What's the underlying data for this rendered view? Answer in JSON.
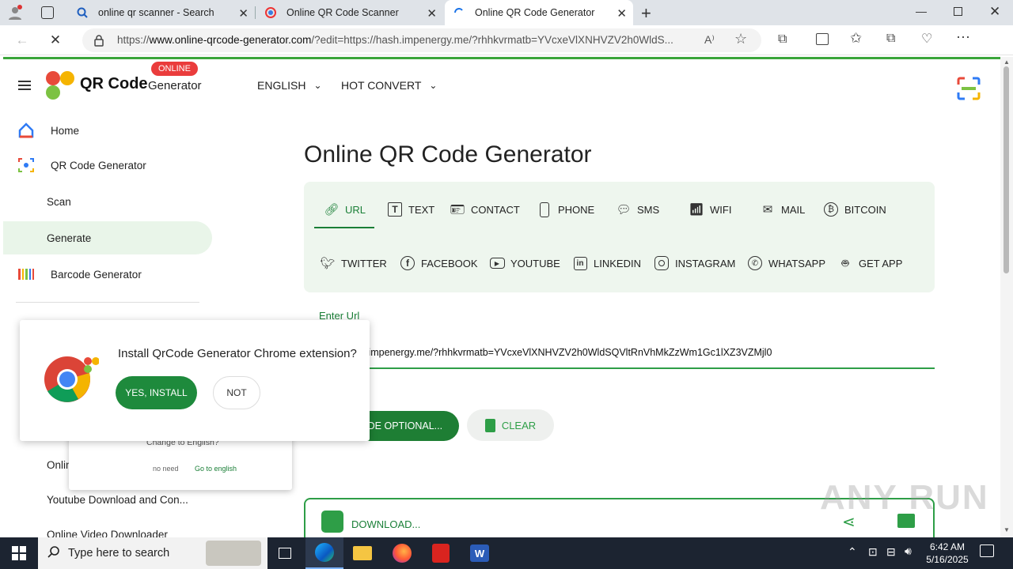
{
  "browser": {
    "tabs": [
      {
        "title": "online qr scanner - Search",
        "icon": "search-icon"
      },
      {
        "title": "Online QR Code Scanner",
        "icon": "qr-favicon"
      },
      {
        "title": "Online QR Code Generator",
        "icon": "loading-spinner-icon",
        "active": true
      }
    ],
    "address": {
      "prefix": "https://",
      "domain": "www.online-qrcode-generator.com",
      "path": "/?edit=https://hash.impenergy.me/?rhhkvrmatb=YVcxeVlXNHVZV2h0WldS..."
    }
  },
  "site": {
    "brand_main": "QR Code",
    "brand_sub": "Generator",
    "badge": "ONLINE",
    "nav": {
      "language": "ENGLISH",
      "convert": "HOT CONVERT"
    }
  },
  "sidebar": {
    "items": [
      {
        "label": "Home",
        "icon": "home-icon"
      },
      {
        "label": "QR Code Generator",
        "icon": "qr-scan-icon"
      },
      {
        "label": "Scan"
      },
      {
        "label": "Generate",
        "active": true
      },
      {
        "label": "Barcode Generator",
        "icon": "barcode-icon"
      }
    ],
    "lower": [
      "Online Converter",
      "Youtube Download and Con...",
      "Online Video Downloader"
    ]
  },
  "main": {
    "title": "Online QR Code Generator",
    "types_row1": [
      {
        "label": "URL",
        "icon": "link-icon",
        "active": true
      },
      {
        "label": "TEXT",
        "icon": "text-icon"
      },
      {
        "label": "CONTACT",
        "icon": "contact-card-icon"
      },
      {
        "label": "PHONE",
        "icon": "phone-icon"
      },
      {
        "label": "SMS",
        "icon": "sms-icon"
      },
      {
        "label": "WIFI",
        "icon": "wifi-icon"
      },
      {
        "label": "MAIL",
        "icon": "mail-icon"
      },
      {
        "label": "BITCOIN",
        "icon": "bitcoin-icon"
      }
    ],
    "types_row2": [
      {
        "label": "TWITTER",
        "icon": "twitter-icon"
      },
      {
        "label": "FACEBOOK",
        "icon": "facebook-icon"
      },
      {
        "label": "YOUTUBE",
        "icon": "youtube-icon"
      },
      {
        "label": "LINKEDIN",
        "icon": "linkedin-icon"
      },
      {
        "label": "INSTAGRAM",
        "icon": "instagram-icon"
      },
      {
        "label": "WHATSAPP",
        "icon": "whatsapp-icon"
      },
      {
        "label": "GET APP",
        "icon": "android-icon"
      }
    ],
    "url_label": "Enter Url",
    "url_value": "h.impenergy.me/?rhhkvrmatb=YVcxeVlXNHVZV2h0WldSQVltRnVhMkZzWm1Gc1lXZ3VZMjl0",
    "optional_button": "ODE OPTIONAL...",
    "clear_button": "CLEAR",
    "download_button": "DOWNLOAD..."
  },
  "lang_popup": {
    "title": "Change to English?",
    "no": "no need",
    "yes": "Go to english"
  },
  "ext_popup": {
    "question": "Install QrCode Generator Chrome extension?",
    "yes": "YES, INSTALL",
    "no": "NOT"
  },
  "taskbar": {
    "search_placeholder": "Type here to search",
    "time": "6:42 AM",
    "date": "5/16/2025"
  },
  "watermark": "ANY RUN",
  "colors": {
    "accent_green": "#1e7e34",
    "badge_red": "#ea3c3c",
    "panel_bg": "#eef6ee"
  }
}
